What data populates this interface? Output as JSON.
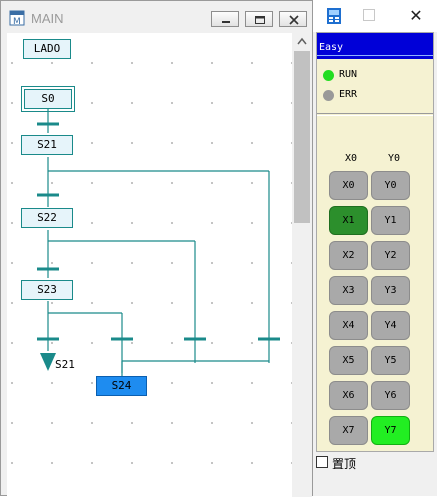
{
  "main_window": {
    "title": "MAIN"
  },
  "ladder": {
    "top_label": "LADO",
    "steps": [
      {
        "id": "s0",
        "label": "S0"
      },
      {
        "id": "s21",
        "label": "S21"
      },
      {
        "id": "s22",
        "label": "S22"
      },
      {
        "id": "s23",
        "label": "S23"
      },
      {
        "id": "s24",
        "label": "S24"
      }
    ],
    "jump_label": "S21",
    "line_color": "#1a8a8a",
    "selected_color": "#1e8cf0"
  },
  "simulator": {
    "header": "Easy",
    "close_glyph": "✕",
    "leds": [
      {
        "label": "RUN",
        "color": "#22dd22"
      },
      {
        "label": "ERR",
        "color": "#999999"
      }
    ],
    "column_x": "X0",
    "column_y": "Y0",
    "inputs": [
      {
        "label": "X0",
        "on": false
      },
      {
        "label": "X1",
        "on": true
      },
      {
        "label": "X2",
        "on": false
      },
      {
        "label": "X3",
        "on": false
      },
      {
        "label": "X4",
        "on": false
      },
      {
        "label": "X5",
        "on": false
      },
      {
        "label": "X6",
        "on": false
      },
      {
        "label": "X7",
        "on": false
      }
    ],
    "outputs": [
      {
        "label": "Y0",
        "on": false
      },
      {
        "label": "Y1",
        "on": false
      },
      {
        "label": "Y2",
        "on": false
      },
      {
        "label": "Y3",
        "on": false
      },
      {
        "label": "Y4",
        "on": false
      },
      {
        "label": "Y5",
        "on": false
      },
      {
        "label": "Y6",
        "on": false
      },
      {
        "label": "Y7",
        "on": true
      }
    ],
    "pin_label": "置顶",
    "pin_checked": false
  }
}
